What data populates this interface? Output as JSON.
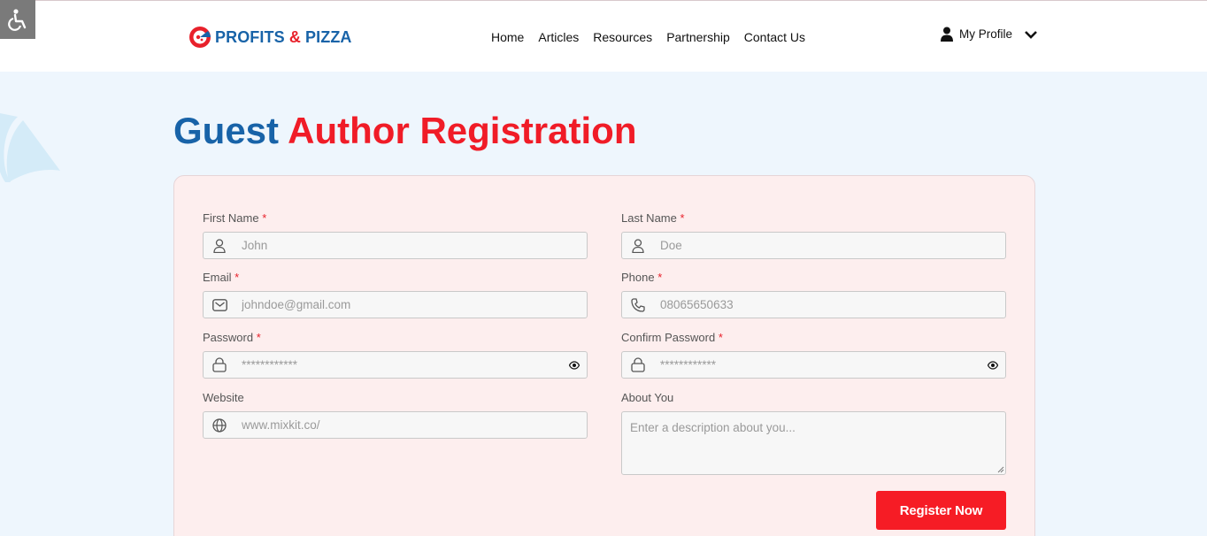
{
  "brand": {
    "part1": "PROFITS",
    "amp": "&",
    "part2": "PIZZA"
  },
  "nav": [
    "Home",
    "Articles",
    "Resources",
    "Partnership",
    "Contact Us"
  ],
  "profile": {
    "label": "My Profile"
  },
  "title": {
    "part1": "Guest",
    "part2": "Author Registration"
  },
  "form": {
    "first_name": {
      "label": "First Name",
      "required": "*",
      "placeholder": "John",
      "icon": "user-icon"
    },
    "last_name": {
      "label": "Last Name",
      "required": "*",
      "placeholder": "Doe",
      "icon": "user-icon"
    },
    "email": {
      "label": "Email",
      "required": "*",
      "placeholder": "johndoe@gmail.com",
      "icon": "mail-icon"
    },
    "phone": {
      "label": "Phone",
      "required": "*",
      "placeholder": "08065650633",
      "icon": "phone-icon"
    },
    "password": {
      "label": "Password",
      "required": "*",
      "placeholder": "************",
      "icon": "lock-icon"
    },
    "confirm_password": {
      "label": "Confirm Password",
      "required": "*",
      "placeholder": "************",
      "icon": "lock-icon"
    },
    "website": {
      "label": "Website",
      "placeholder": "www.mixkit.co/",
      "icon": "globe-icon"
    },
    "about": {
      "label": "About You",
      "placeholder": "Enter a description about you..."
    }
  },
  "submit": {
    "label": "Register Now"
  },
  "colors": {
    "brand_blue": "#1863a8",
    "brand_red": "#f01c27",
    "button_red": "#f61c25",
    "card_bg": "#fdeeee",
    "page_bg": "#eef6fd"
  }
}
